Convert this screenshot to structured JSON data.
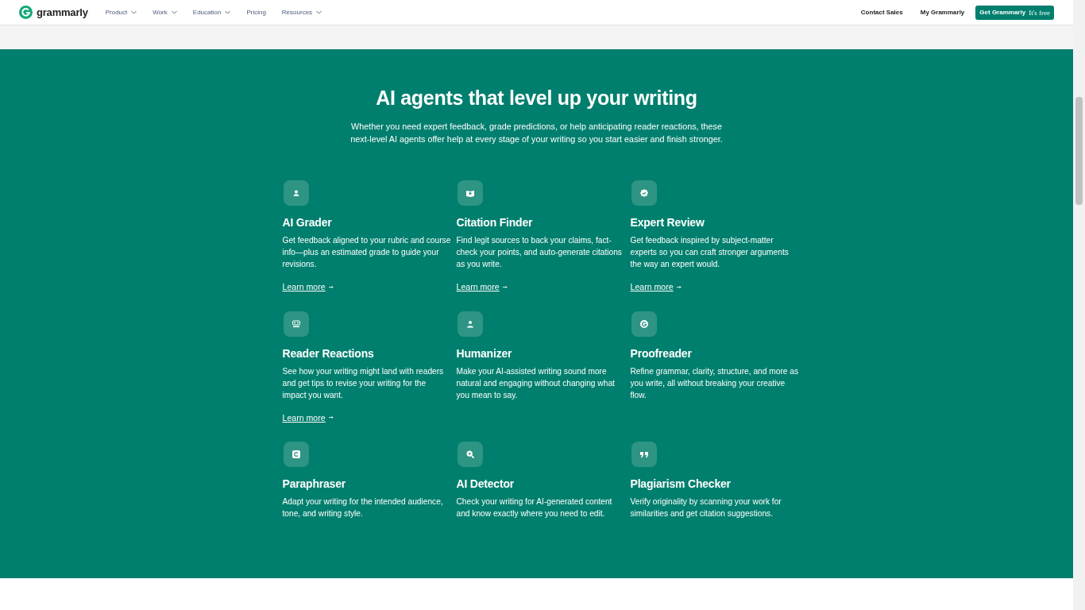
{
  "header": {
    "logo_text": "grammarly",
    "nav": [
      {
        "label": "Product",
        "has_menu": true
      },
      {
        "label": "Work",
        "has_menu": true
      },
      {
        "label": "Education",
        "has_menu": true
      },
      {
        "label": "Pricing",
        "has_menu": false
      },
      {
        "label": "Resources",
        "has_menu": true
      }
    ],
    "contact_sales": "Contact Sales",
    "my_grammarly": "My Grammarly",
    "cta": {
      "label": "Get Grammarly",
      "note": "It's free"
    }
  },
  "section": {
    "title": "AI agents that level up your writing",
    "subtitle": "Whether you need expert feedback, grade predictions, or help anticipating reader reactions, these next-level AI agents offer help at every stage of your writing so you start easier and finish stronger.",
    "cards": [
      {
        "title": "AI Grader",
        "text": "Get feedback aligned to your rubric and course info—plus an estimated grade to guide your revisions.",
        "link": "Learn more"
      },
      {
        "title": "Citation Finder",
        "text": "Find legit sources to back your claims, fact-check your points, and auto-generate citations as you write.",
        "link": "Learn more"
      },
      {
        "title": "Expert Review",
        "text": "Get feedback inspired by subject-matter experts so you can craft stronger arguments the way an expert would.",
        "link": "Learn more"
      },
      {
        "title": "Reader Reactions",
        "text": "See how your writing might land with readers and get tips to revise your writing for the impact you want.",
        "link": "Learn more"
      },
      {
        "title": "Humanizer",
        "text": "Make your AI-assisted writing sound more natural and engaging without changing what you mean to say."
      },
      {
        "title": "Proofreader",
        "text": "Refine grammar, clarity, structure, and more as you write, all without breaking your creative flow."
      },
      {
        "title": "Paraphraser",
        "text": "Adapt your writing for the intended audience, tone, and writing style."
      },
      {
        "title": "AI Detector",
        "text": "Check your writing for AI-generated content and know exactly where you need to edit."
      },
      {
        "title": "Plagiarism Checker",
        "text": "Verify originality by scanning your work for similarities and get citation suggestions."
      }
    ]
  }
}
